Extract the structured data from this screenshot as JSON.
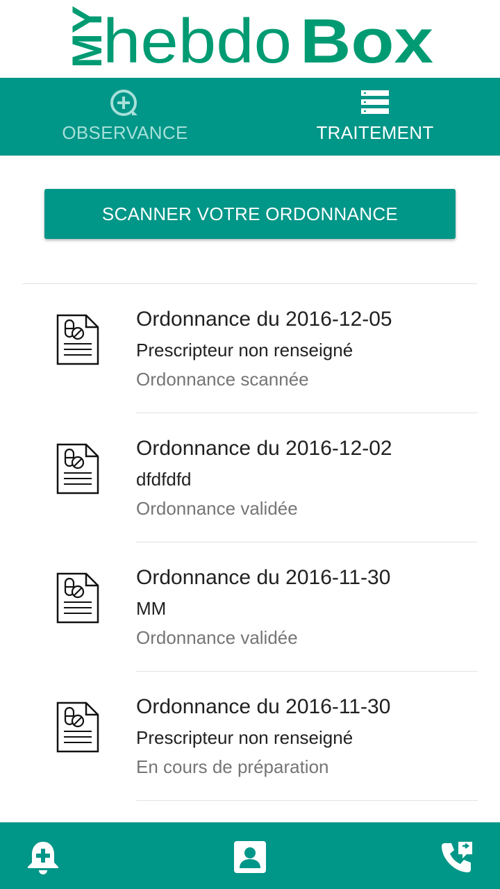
{
  "logo": {
    "my": "MY",
    "hebdo": "hebdo",
    "box": "Box"
  },
  "tabs": [
    {
      "label": "OBSERVANCE",
      "icon": "plus-circle-icon",
      "state": "inactive"
    },
    {
      "label": "TRAITEMENT",
      "icon": "list-icon",
      "state": "active"
    }
  ],
  "scan_button": {
    "label": "SCANNER VOTRE ORDONNANCE"
  },
  "prescriptions": [
    {
      "title": "Ordonnance du 2016-12-05",
      "prescriber": "Prescripteur non renseigné",
      "status": "Ordonnance scannée"
    },
    {
      "title": "Ordonnance du 2016-12-02",
      "prescriber": "dfdfdfd",
      "status": "Ordonnance validée"
    },
    {
      "title": "Ordonnance du 2016-11-30",
      "prescriber": "MM",
      "status": "Ordonnance validée"
    },
    {
      "title": "Ordonnance du 2016-11-30",
      "prescriber": "Prescripteur non renseigné",
      "status": "En cours de préparation"
    }
  ],
  "bottom_bar": {
    "items": [
      {
        "icon": "medical-bell-icon"
      },
      {
        "icon": "contact-card-icon"
      },
      {
        "icon": "phone-forward-icon"
      }
    ]
  },
  "colors": {
    "primary": "#009688",
    "tab_inactive_text": "#a6e0d9",
    "logo_green": "#009b72"
  }
}
